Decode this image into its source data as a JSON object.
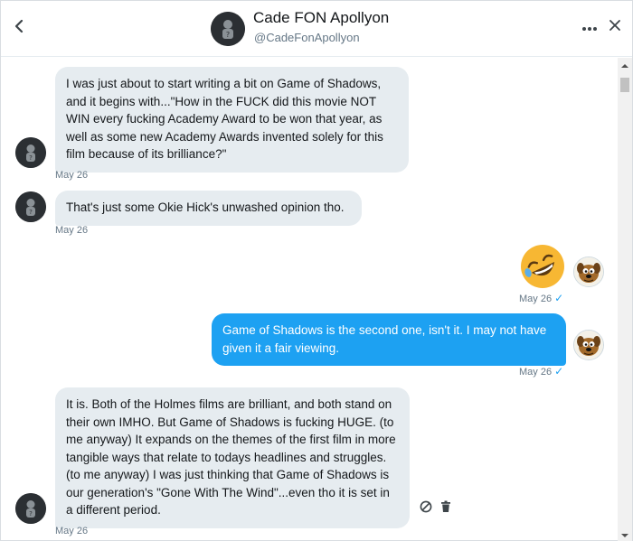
{
  "header": {
    "name": "Cade FON Apollyon",
    "handle": "@CadeFonApollyon"
  },
  "messages": [
    {
      "direction": "in",
      "text": "I was just about to start writing a bit on Game of Shadows, and it begins with...\"How in the FUCK did this movie NOT WIN every fucking Academy Award to be won that year, as well as some new Academy Awards invented solely for this film because of its brilliance?\"",
      "time": "May 26"
    },
    {
      "direction": "in",
      "text": "That's just some Okie Hick's unwashed opinion tho.",
      "time": "May 26"
    },
    {
      "direction": "out",
      "emoji": "rolling-on-floor-laughing",
      "time": "May 26",
      "read": true
    },
    {
      "direction": "out",
      "text": "Game of Shadows is the second one, isn't it. I may not have given it a fair viewing.",
      "time": "May 26",
      "read": true
    },
    {
      "direction": "in",
      "text": "It is. Both of the Holmes films are brilliant, and both stand on their own IMHO. But Game of Shadows is fucking HUGE. (to me anyway) It expands on the themes of the first film in more tangible ways that relate to todays headlines and struggles. (to me anyway) I was just thinking that Game of Shadows is our generation's \"Gone With The Wind\"...even tho it is set in a different period.",
      "time": "May 26"
    }
  ],
  "icons": {
    "back": "chevron-left-icon",
    "more": "more-dots-icon",
    "close": "close-icon",
    "report": "block-icon",
    "delete": "trash-icon",
    "read_check": "checkmark-icon"
  },
  "colors": {
    "accent": "#1da1f2",
    "incoming_bubble": "#e6ecf0",
    "timestamp": "#657786"
  }
}
